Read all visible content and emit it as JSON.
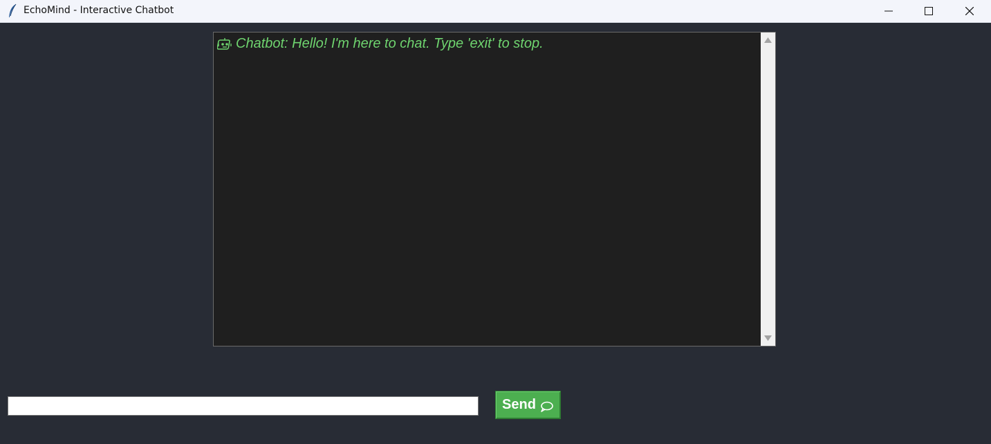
{
  "window": {
    "title": "EchoMind - Interactive Chatbot",
    "app_icon": "feather-icon",
    "controls": [
      "minimize-icon",
      "maximize-icon",
      "close-icon"
    ]
  },
  "chat": {
    "messages": [
      {
        "icon": "robot-icon",
        "text": "Chatbot: Hello! I'm here to chat. Type 'exit' to stop."
      }
    ],
    "background": "#1f1f1f",
    "text_color": "#6fd46f"
  },
  "input": {
    "value": "",
    "placeholder": ""
  },
  "send_button": {
    "label": "Send",
    "icon": "speech-bubble-icon",
    "color": "#4caf50"
  },
  "colors": {
    "window_bg": "#282c35",
    "titlebar_bg": "#f3f5fb"
  }
}
